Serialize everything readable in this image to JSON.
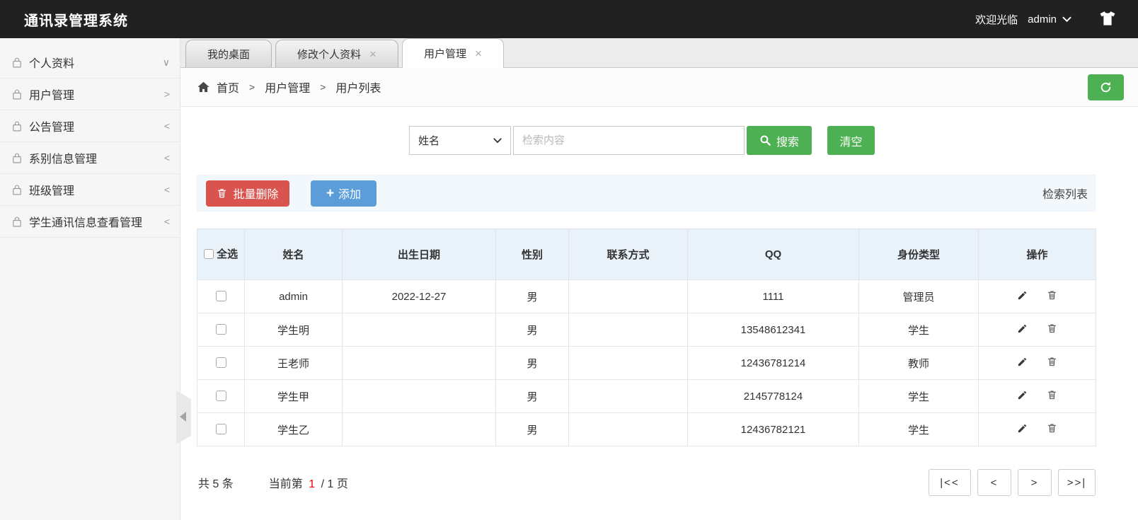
{
  "header": {
    "title": "通讯录管理系统",
    "welcome": "欢迎光临",
    "username": "admin"
  },
  "sidebar": {
    "items": [
      {
        "label": "个人资料",
        "arrow": "∨"
      },
      {
        "label": "用户管理",
        "arrow": ">"
      },
      {
        "label": "公告管理",
        "arrow": "<"
      },
      {
        "label": "系别信息管理",
        "arrow": "<"
      },
      {
        "label": "班级管理",
        "arrow": "<"
      },
      {
        "label": "学生通讯信息查看管理",
        "arrow": "<"
      }
    ]
  },
  "tabs": [
    {
      "label": "我的桌面"
    },
    {
      "label": "修改个人资料"
    },
    {
      "label": "用户管理"
    }
  ],
  "glyphs": {
    "close": "×",
    "breadcrumb_sep": ">",
    "plus": "+"
  },
  "breadcrumb": {
    "items": [
      "首页",
      "用户管理",
      "用户列表"
    ]
  },
  "search": {
    "field_selected": "姓名",
    "placeholder": "检索内容",
    "search_label": "搜索",
    "clear_label": "清空"
  },
  "toolbar": {
    "batch_delete_label": "批量删除",
    "add_label": "添加",
    "panel_title": "检索列表"
  },
  "table": {
    "select_all_label": "全选",
    "headers": [
      "姓名",
      "出生日期",
      "性别",
      "联系方式",
      "QQ",
      "身份类型",
      "操作"
    ],
    "rows": [
      {
        "name": "admin",
        "birthday": "2022-12-27",
        "gender": "男",
        "contact": "",
        "qq": "1111",
        "role": "管理员"
      },
      {
        "name": "学生明",
        "birthday": "",
        "gender": "男",
        "contact": "",
        "qq": "13548612341",
        "role": "学生"
      },
      {
        "name": "王老师",
        "birthday": "",
        "gender": "男",
        "contact": "",
        "qq": "12436781214",
        "role": "教师"
      },
      {
        "name": "学生甲",
        "birthday": "",
        "gender": "男",
        "contact": "",
        "qq": "2145778124",
        "role": "学生"
      },
      {
        "name": "学生乙",
        "birthday": "",
        "gender": "男",
        "contact": "",
        "qq": "12436782121",
        "role": "学生"
      }
    ]
  },
  "pagination": {
    "total_text": "共 5 条",
    "current_label": "当前第",
    "current_page": "1",
    "total_suffix": "/ 1 页",
    "buttons": [
      "|<<",
      "<",
      ">",
      ">>|"
    ]
  },
  "colors": {
    "topbar_bg": "#212121",
    "green": "#4db052",
    "red": "#d9534f",
    "blue": "#5b9dd9",
    "panel_bg": "#f3f8fd",
    "table_header_bg": "#e9f1f9",
    "page_number_red": "#f20000"
  }
}
